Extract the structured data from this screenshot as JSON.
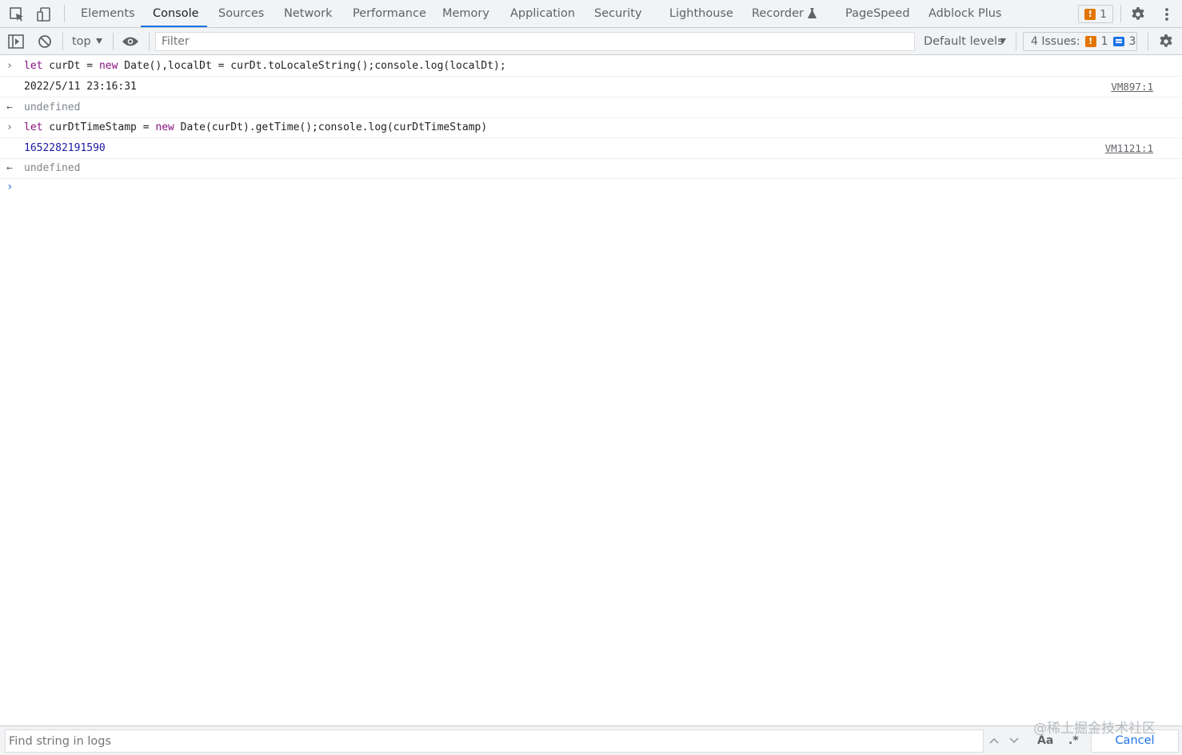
{
  "tabs": [
    {
      "label": "Elements",
      "active": false
    },
    {
      "label": "Console",
      "active": true
    },
    {
      "label": "Sources",
      "active": false
    },
    {
      "label": "Network",
      "active": false
    },
    {
      "label": "Performance",
      "active": false
    },
    {
      "label": "Memory",
      "active": false
    },
    {
      "label": "Application",
      "active": false
    },
    {
      "label": "Security",
      "active": false
    },
    {
      "label": "Lighthouse",
      "active": false
    },
    {
      "label": "Recorder",
      "active": false
    },
    {
      "label": "PageSpeed",
      "active": false
    },
    {
      "label": "Adblock Plus",
      "active": false
    }
  ],
  "issue_counter": {
    "warnings": "1"
  },
  "toolbar": {
    "context": "top",
    "filter_placeholder": "Filter",
    "levels": "Default levels",
    "issues_label": "4 Issues:",
    "issues_warnings": "1",
    "issues_info": "3"
  },
  "console": {
    "messages": [
      {
        "kind": "input",
        "code": "let curDt = new Date(),localDt = curDt.toLocaleString();console.log(localDt);"
      },
      {
        "kind": "log",
        "text": "2022/5/11 23:16:31",
        "source": "VM897:1"
      },
      {
        "kind": "result",
        "text": "undefined"
      },
      {
        "kind": "input",
        "code": "let curDtTimeStamp = new Date(curDt).getTime();console.log(curDtTimeStamp)"
      },
      {
        "kind": "log",
        "text": "1652282191590",
        "source": "VM1121:1"
      },
      {
        "kind": "result",
        "text": "undefined"
      }
    ]
  },
  "findbar": {
    "placeholder": "Find string in logs",
    "match_case": "Aa",
    "regex": ".*",
    "cancel": "Cancel"
  },
  "watermark": "@稀土掘金技术社区",
  "colors": {
    "accent": "#1a73e8",
    "warning": "#e37400",
    "keyword": "#881280",
    "number": "#1a1aa6"
  }
}
